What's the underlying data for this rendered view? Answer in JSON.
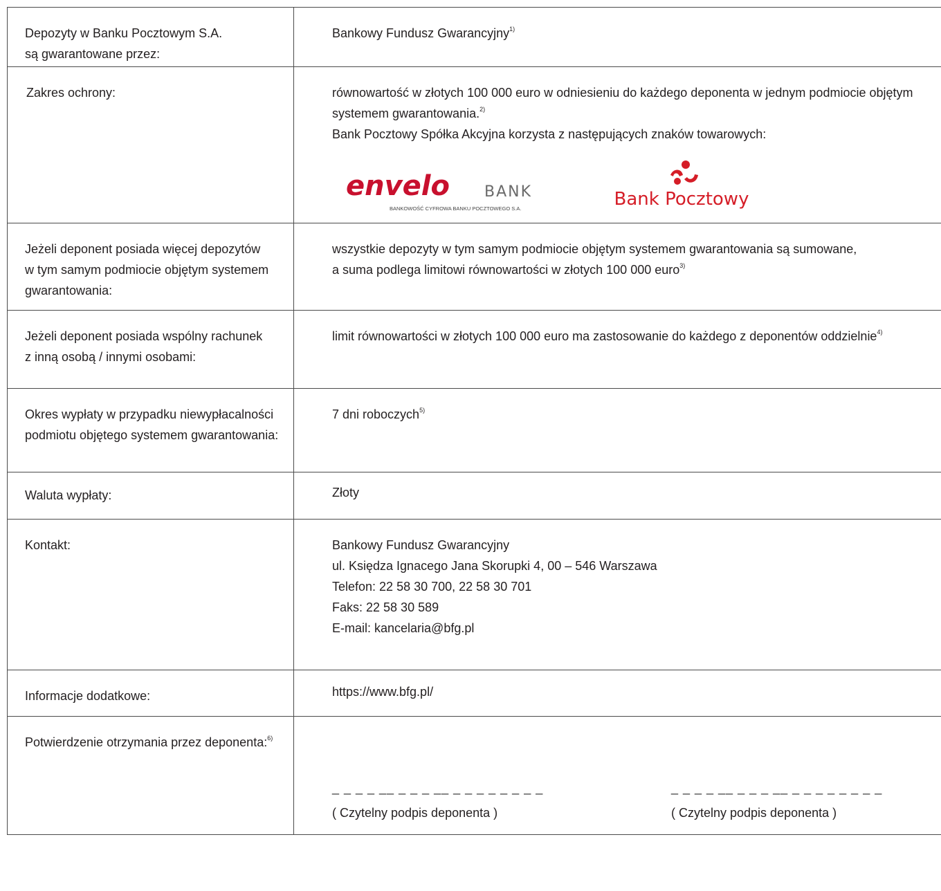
{
  "rows": {
    "depozyty": {
      "label_lines": [
        "Depozyty w Banku Pocztowym S.A.",
        "są gwarantowane przez:"
      ],
      "value": "Bankowy Fundusz Gwarancyjny",
      "note": "1)"
    },
    "zakres": {
      "label": "Zakres ochrony:",
      "value_line1": "równowartość w złotych 100 000 euro w odniesieniu do każdego deponenta w jednym podmiocie objętym",
      "value_line2": "systemem gwarantowania.",
      "note": "2)",
      "value_line3": "Bank Pocztowy Spółka Akcyjna korzysta z następujących znaków towarowych:",
      "logo_envelo_word": "envelo",
      "logo_envelo_bank": "BANK",
      "logo_envelo_sub": "BANKOWOŚĆ CYFROWA BANKU POCZTOWEGO S.A.",
      "logo_bp_word": "Bank Pocztowy"
    },
    "wiecej": {
      "label_lines": [
        "Jeżeli deponent posiada więcej depozytów",
        "w tym samym podmiocie objętym systemem",
        "gwarantowania:"
      ],
      "value_line1": "wszystkie depozyty w tym samym podmiocie objętym systemem gwarantowania są sumowane,",
      "value_line2": "a suma podlega limitowi równowartości w złotych 100 000 euro",
      "note": "3)"
    },
    "wspolny": {
      "label_lines": [
        "Jeżeli deponent posiada wspólny rachunek",
        "z inną osobą / innymi osobami:"
      ],
      "value": "limit równowartości w złotych 100 000 euro ma zastosowanie do każdego z deponentów oddzielnie",
      "note": "4)"
    },
    "okres": {
      "label_lines": [
        "Okres wypłaty w przypadku niewypłacalności",
        "podmiotu objętego systemem gwarantowania:"
      ],
      "value": "7 dni roboczych",
      "note": "5)"
    },
    "waluta": {
      "label": "Waluta wypłaty:",
      "value": "Złoty"
    },
    "kontakt": {
      "label": "Kontakt:",
      "lines": [
        "Bankowy Fundusz Gwarancyjny",
        "ul. Księdza Ignacego Jana Skorupki 4,  00 – 546  Warszawa",
        "Telefon:  22 58 30 700, 22 58 30 701",
        "Faks:  22 58 30 589",
        "E-mail: kancelaria@bfg.pl"
      ]
    },
    "info": {
      "label": "Informacje dodatkowe:",
      "value": "https://www.bfg.pl/"
    },
    "potwierdzenie": {
      "label": "Potwierdzenie otrzymania przez deponenta:",
      "note": "6)",
      "sig_dashes": "_ _ _ _ __ _ _ _ __ _ _ _ _ _ _ _ _",
      "sig1": "( Czytelny podpis deponenta )",
      "sig2": "( Czytelny podpis deponenta )"
    }
  },
  "colors": {
    "border": "#4a4a4a",
    "text": "#231f20",
    "envelo_red": "#c8102e",
    "bp_red": "#d51d27"
  }
}
